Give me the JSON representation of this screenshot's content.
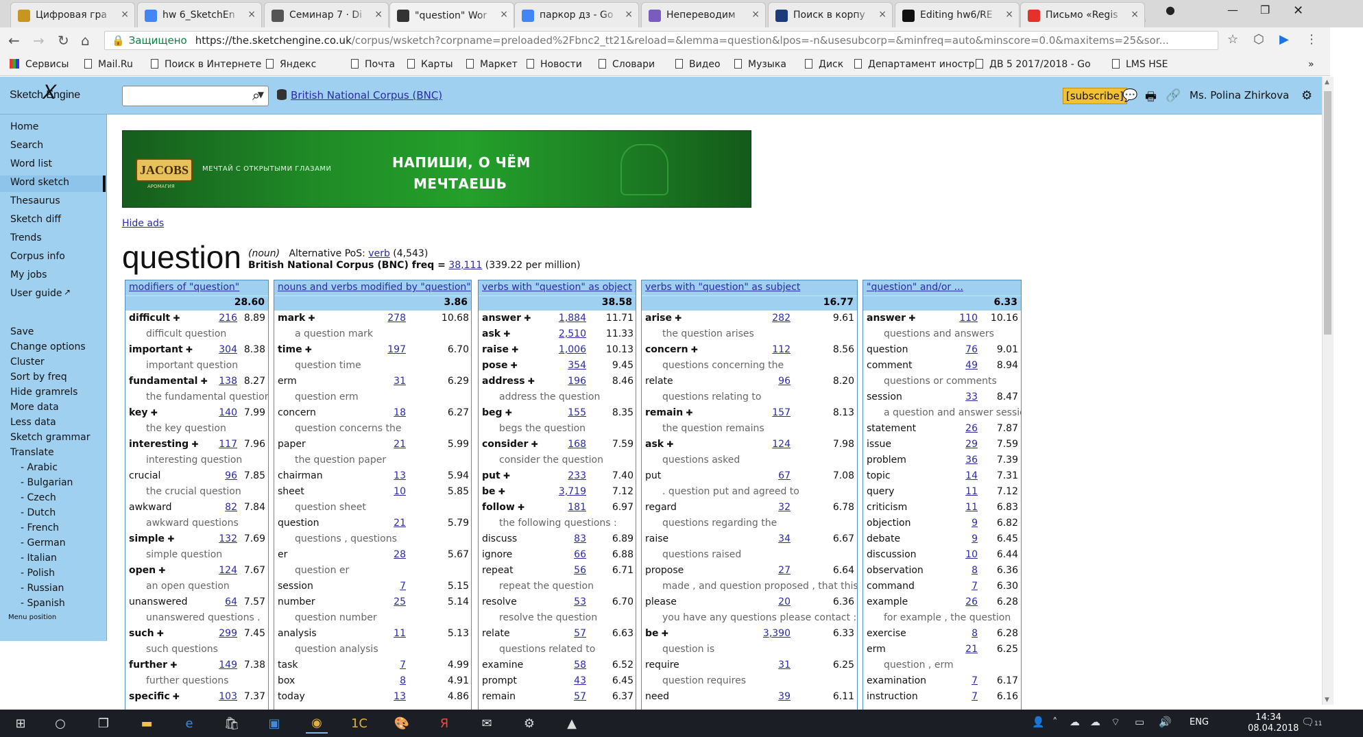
{
  "browser": {
    "tabs": [
      {
        "title": "Цифровая гра",
        "icon": "gold-circle-icon",
        "color": "#c8961e"
      },
      {
        "title": "hw 6_SketchEn",
        "icon": "google-docs-icon",
        "color": "#4285f4"
      },
      {
        "title": "Семинар 7 · Di",
        "icon": "book-icon",
        "color": "#555555"
      },
      {
        "title": "\"question\" Wor",
        "icon": "sketch-engine-icon",
        "color": "#333333"
      },
      {
        "title": "паркор дз - Go",
        "icon": "google-docs-icon",
        "color": "#4285f4"
      },
      {
        "title": "Непереводим",
        "icon": "person-icon",
        "color": "#7a5cc0"
      },
      {
        "title": "Поиск в корпу",
        "icon": "corpus-icon",
        "color": "#1a3c7a"
      },
      {
        "title": "Editing hw6/RE",
        "icon": "github-icon",
        "color": "#111111"
      },
      {
        "title": "Письмо «Regis",
        "icon": "mail-ru-icon",
        "color": "#e2322b"
      }
    ],
    "url": {
      "secure_label": "Защищено",
      "host": "https://the.sketchengine.co.uk",
      "path": "/corpus/wsketch?corpname=preloaded%2Fbnc2_tt21&reload=&lemma=question&lpos=-n&usesubcorp=&minfreq=auto&minscore=0.0&maxitems=25&sor..."
    },
    "bookmarks": [
      "Сервисы",
      "Mail.Ru",
      "Поиск в Интернете",
      "Яндекс",
      "Почта",
      "Карты",
      "Маркет",
      "Новости",
      "Словари",
      "Видео",
      "Музыка",
      "Диск",
      "Департамент иностр",
      "ДВ 5 2017/2018 - Go",
      "LMS HSE"
    ],
    "more": "»"
  },
  "site": {
    "logo": "Sketch Engine",
    "corpus_link": "British National Corpus (BNC)",
    "subscribe": "[subscribe]",
    "user": "Ms. Polina Zhirkova"
  },
  "sidebar": {
    "items": [
      "Home",
      "Search",
      "Word list",
      "Word sketch",
      "Thesaurus",
      "Sketch diff",
      "Trends",
      "Corpus info",
      "My jobs",
      "User guide"
    ],
    "actions": [
      "Save",
      "Change options",
      "Cluster",
      "Sort by freq",
      "Hide gramrels",
      "More data",
      "Less data",
      "Sketch grammar",
      "Translate"
    ],
    "languages": [
      "- Arabic",
      "- Bulgarian",
      "- Czech",
      "- Dutch",
      "- French",
      "- German",
      "- Italian",
      "- Polish",
      "- Russian",
      "- Spanish"
    ],
    "menu_position": "Menu position"
  },
  "ad": {
    "brand": "JACOBS",
    "brand_sub": "АРОМАГИЯ",
    "slogan": "МЕЧТАЙ С ОТКРЫТЫМИ ГЛАЗАМИ",
    "line1": "НАПИШИ, О ЧЁМ",
    "line2": "МЕЧТАЕШЬ",
    "hide": "Hide ads"
  },
  "lemma": {
    "word": "question",
    "pos": "(noun)",
    "alt_label": "Alternative PoS:",
    "alt_pos": "verb",
    "alt_count": "(4,543)",
    "freq_label": "British National Corpus (BNC) freq =",
    "freq": "38,111",
    "per_million": "(339.22 per million)"
  },
  "columns": [
    {
      "title": "modifiers of \"question\"",
      "score": "28.60",
      "rows": [
        {
          "w": "difficult",
          "b": true,
          "f": "216",
          "s": "8.89",
          "e": "difficult question"
        },
        {
          "w": "important",
          "b": true,
          "f": "304",
          "s": "8.38",
          "e": "important question"
        },
        {
          "w": "fundamental",
          "b": true,
          "f": "138",
          "s": "8.27",
          "e": "the fundamental question"
        },
        {
          "w": "key",
          "b": true,
          "f": "140",
          "s": "7.99",
          "e": "the key question"
        },
        {
          "w": "interesting",
          "b": true,
          "f": "117",
          "s": "7.96",
          "e": "interesting question"
        },
        {
          "w": "crucial",
          "b": false,
          "f": "96",
          "s": "7.85",
          "e": "the crucial question"
        },
        {
          "w": "awkward",
          "b": false,
          "f": "82",
          "s": "7.84",
          "e": "awkward questions"
        },
        {
          "w": "simple",
          "b": true,
          "f": "132",
          "s": "7.69",
          "e": "simple question"
        },
        {
          "w": "open",
          "b": true,
          "f": "124",
          "s": "7.67",
          "e": "an open question"
        },
        {
          "w": "unanswered",
          "b": false,
          "f": "64",
          "s": "7.57",
          "e": "unanswered questions ."
        },
        {
          "w": "such",
          "b": true,
          "f": "299",
          "s": "7.45",
          "e": "such questions"
        },
        {
          "w": "further",
          "b": true,
          "f": "149",
          "s": "7.38",
          "e": "further questions"
        },
        {
          "w": "specific",
          "b": true,
          "f": "103",
          "s": "7.37",
          "e": ""
        }
      ]
    },
    {
      "title": "nouns and verbs modified by \"question\"",
      "score": "3.86",
      "rows": [
        {
          "w": "mark",
          "b": true,
          "f": "278",
          "s": "10.68",
          "e": "a question mark"
        },
        {
          "w": "time",
          "b": true,
          "f": "197",
          "s": "6.70",
          "e": "question time"
        },
        {
          "w": "erm",
          "b": false,
          "f": "31",
          "s": "6.29",
          "e": "question erm"
        },
        {
          "w": "concern",
          "b": false,
          "f": "18",
          "s": "6.27",
          "e": "question concerns the"
        },
        {
          "w": "paper",
          "b": false,
          "f": "21",
          "s": "5.99",
          "e": "the question paper"
        },
        {
          "w": "chairman",
          "b": false,
          "f": "13",
          "s": "5.94",
          "e": ""
        },
        {
          "w": "sheet",
          "b": false,
          "f": "10",
          "s": "5.85",
          "e": "question sheet"
        },
        {
          "w": "question",
          "b": false,
          "f": "21",
          "s": "5.79",
          "e": "questions , questions"
        },
        {
          "w": "er",
          "b": false,
          "f": "28",
          "s": "5.67",
          "e": "question er"
        },
        {
          "w": "session",
          "b": false,
          "f": "7",
          "s": "5.15",
          "e": ""
        },
        {
          "w": "number",
          "b": false,
          "f": "25",
          "s": "5.14",
          "e": "question number"
        },
        {
          "w": "analysis",
          "b": false,
          "f": "11",
          "s": "5.13",
          "e": "question analysis"
        },
        {
          "w": "task",
          "b": false,
          "f": "7",
          "s": "4.99",
          "e": ""
        },
        {
          "w": "box",
          "b": false,
          "f": "8",
          "s": "4.91",
          "e": ""
        },
        {
          "w": "today",
          "b": false,
          "f": "13",
          "s": "4.86",
          "e": ""
        }
      ]
    },
    {
      "title": "verbs with \"question\" as object",
      "score": "38.58",
      "rows": [
        {
          "w": "answer",
          "b": true,
          "f": "1,884",
          "s": "11.71",
          "e": ""
        },
        {
          "w": "ask",
          "b": true,
          "f": "2,510",
          "s": "11.33",
          "e": ""
        },
        {
          "w": "raise",
          "b": true,
          "f": "1,006",
          "s": "10.13",
          "e": ""
        },
        {
          "w": "pose",
          "b": true,
          "f": "354",
          "s": "9.45",
          "e": ""
        },
        {
          "w": "address",
          "b": true,
          "f": "196",
          "s": "8.46",
          "e": "address the question"
        },
        {
          "w": "beg",
          "b": true,
          "f": "155",
          "s": "8.35",
          "e": "begs the question"
        },
        {
          "w": "consider",
          "b": true,
          "f": "168",
          "s": "7.59",
          "e": "consider the question"
        },
        {
          "w": "put",
          "b": true,
          "f": "233",
          "s": "7.40",
          "e": ""
        },
        {
          "w": "be",
          "b": true,
          "f": "3,719",
          "s": "7.12",
          "e": ""
        },
        {
          "w": "follow",
          "b": true,
          "f": "181",
          "s": "6.97",
          "e": "the following questions :"
        },
        {
          "w": "discuss",
          "b": false,
          "f": "83",
          "s": "6.89",
          "e": ""
        },
        {
          "w": "ignore",
          "b": false,
          "f": "66",
          "s": "6.88",
          "e": ""
        },
        {
          "w": "repeat",
          "b": false,
          "f": "56",
          "s": "6.71",
          "e": "repeat the question"
        },
        {
          "w": "resolve",
          "b": false,
          "f": "53",
          "s": "6.70",
          "e": "resolve the question"
        },
        {
          "w": "relate",
          "b": false,
          "f": "57",
          "s": "6.63",
          "e": "questions related to"
        },
        {
          "w": "examine",
          "b": false,
          "f": "58",
          "s": "6.52",
          "e": ""
        },
        {
          "w": "prompt",
          "b": false,
          "f": "43",
          "s": "6.45",
          "e": ""
        },
        {
          "w": "remain",
          "b": false,
          "f": "57",
          "s": "6.37",
          "e": ""
        }
      ]
    },
    {
      "title": "verbs with \"question\" as subject",
      "score": "16.77",
      "rows": [
        {
          "w": "arise",
          "b": true,
          "f": "282",
          "s": "9.61",
          "e": "the question arises"
        },
        {
          "w": "concern",
          "b": true,
          "f": "112",
          "s": "8.56",
          "e": "questions concerning the"
        },
        {
          "w": "relate",
          "b": false,
          "f": "96",
          "s": "8.20",
          "e": "questions relating to"
        },
        {
          "w": "remain",
          "b": true,
          "f": "157",
          "s": "8.13",
          "e": "the question remains"
        },
        {
          "w": "ask",
          "b": true,
          "f": "124",
          "s": "7.98",
          "e": "questions asked"
        },
        {
          "w": "put",
          "b": false,
          "f": "67",
          "s": "7.08",
          "e": ". question put and agreed to"
        },
        {
          "w": "regard",
          "b": false,
          "f": "32",
          "s": "6.78",
          "e": "questions regarding the"
        },
        {
          "w": "raise",
          "b": false,
          "f": "34",
          "s": "6.67",
          "e": "questions raised"
        },
        {
          "w": "propose",
          "b": false,
          "f": "27",
          "s": "6.64",
          "e": "made , and question proposed , that this"
        },
        {
          "w": "please",
          "b": false,
          "f": "20",
          "s": "6.36",
          "e": "you have any questions please contact : ("
        },
        {
          "w": "be",
          "b": true,
          "f": "3,390",
          "s": "6.33",
          "e": "question is"
        },
        {
          "w": "require",
          "b": false,
          "f": "31",
          "s": "6.25",
          "e": "question requires"
        },
        {
          "w": "need",
          "b": false,
          "f": "39",
          "s": "6.11",
          "e": ""
        }
      ]
    },
    {
      "title": "\"question\" and/or ...",
      "score": "6.33",
      "rows": [
        {
          "w": "answer",
          "b": true,
          "f": "110",
          "s": "10.16",
          "e": "questions and answers"
        },
        {
          "w": "question",
          "b": false,
          "f": "76",
          "s": "9.01",
          "e": ""
        },
        {
          "w": "comment",
          "b": false,
          "f": "49",
          "s": "8.94",
          "e": "questions or comments"
        },
        {
          "w": "session",
          "b": false,
          "f": "33",
          "s": "8.47",
          "e": "a question and answer session"
        },
        {
          "w": "statement",
          "b": false,
          "f": "26",
          "s": "7.87",
          "e": ""
        },
        {
          "w": "issue",
          "b": false,
          "f": "29",
          "s": "7.59",
          "e": ""
        },
        {
          "w": "problem",
          "b": false,
          "f": "36",
          "s": "7.39",
          "e": ""
        },
        {
          "w": "topic",
          "b": false,
          "f": "14",
          "s": "7.31",
          "e": ""
        },
        {
          "w": "query",
          "b": false,
          "f": "11",
          "s": "7.12",
          "e": ""
        },
        {
          "w": "criticism",
          "b": false,
          "f": "11",
          "s": "6.83",
          "e": ""
        },
        {
          "w": "objection",
          "b": false,
          "f": "9",
          "s": "6.82",
          "e": ""
        },
        {
          "w": "debate",
          "b": false,
          "f": "9",
          "s": "6.45",
          "e": ""
        },
        {
          "w": "discussion",
          "b": false,
          "f": "10",
          "s": "6.44",
          "e": ""
        },
        {
          "w": "observation",
          "b": false,
          "f": "8",
          "s": "6.36",
          "e": ""
        },
        {
          "w": "command",
          "b": false,
          "f": "7",
          "s": "6.30",
          "e": ""
        },
        {
          "w": "example",
          "b": false,
          "f": "26",
          "s": "6.28",
          "e": "for example , the question"
        },
        {
          "w": "exercise",
          "b": false,
          "f": "8",
          "s": "6.28",
          "e": ""
        },
        {
          "w": "erm",
          "b": false,
          "f": "21",
          "s": "6.25",
          "e": "question , erm"
        },
        {
          "w": "examination",
          "b": false,
          "f": "7",
          "s": "6.17",
          "e": ""
        },
        {
          "w": "instruction",
          "b": false,
          "f": "7",
          "s": "6.16",
          "e": ""
        }
      ]
    }
  ],
  "taskbar": {
    "lang": "ENG",
    "time": "14:34",
    "date": "08.04.2018",
    "notif": "11"
  },
  "colors": {
    "accent": "#9fd0f0",
    "link": "#2a2aa8",
    "secure": "#0b8043"
  }
}
